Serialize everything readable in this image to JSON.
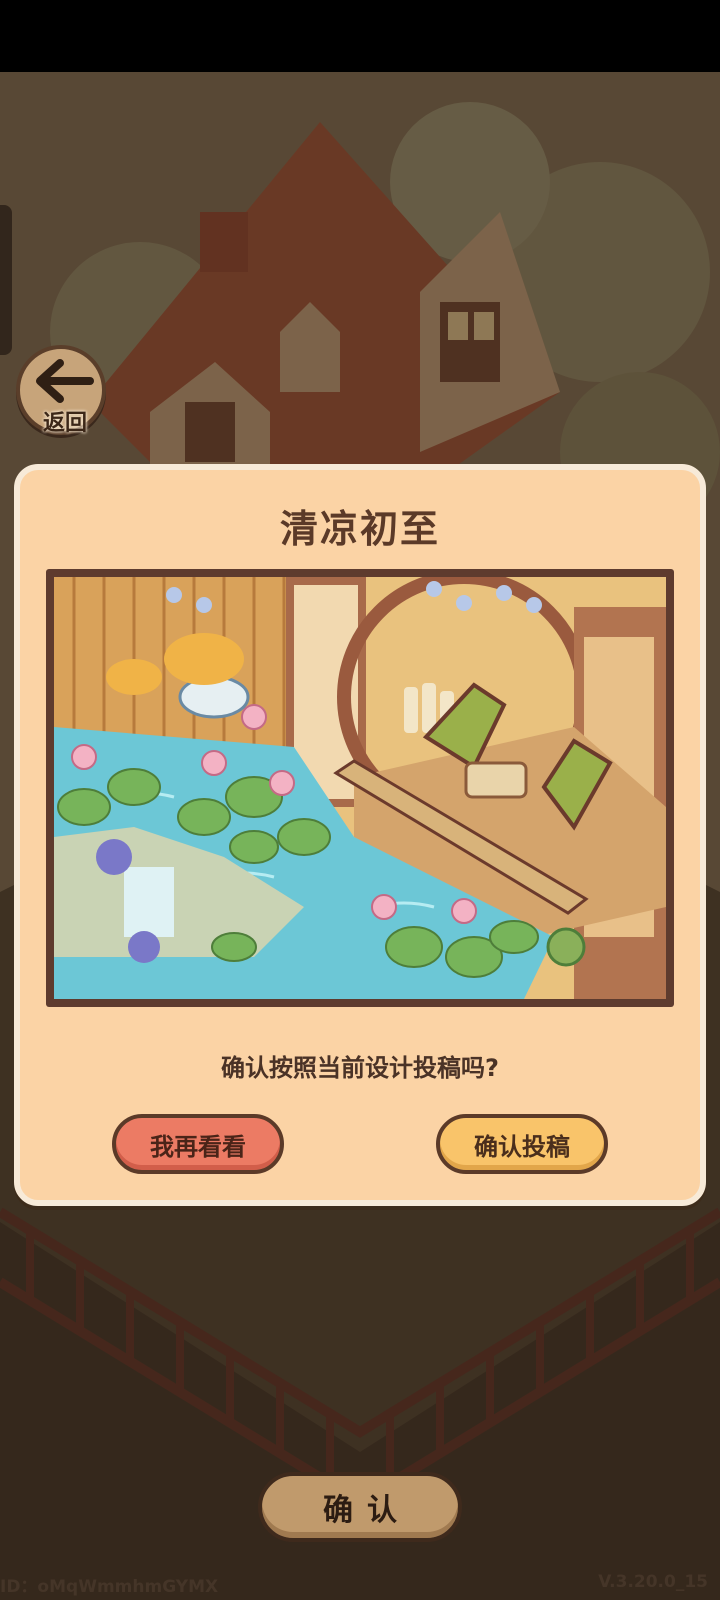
{
  "back_button": {
    "label": "返回",
    "icon": "left-arrow-icon"
  },
  "dialog": {
    "title": "清凉初至",
    "question": "确认按照当前设计投稿吗?",
    "cancel_label": "我再看看",
    "submit_label": "确认投稿"
  },
  "bottom_button": {
    "label": "确认"
  },
  "footer": {
    "player_id": "ID：oMqWmmhmGYMX",
    "version": "V.3.20.0_15"
  },
  "colors": {
    "dialog_bg": "#fbd3a5",
    "cancel_button": "#ec7b64",
    "submit_button": "#f9c46a",
    "title_text": "#5b3a28"
  }
}
